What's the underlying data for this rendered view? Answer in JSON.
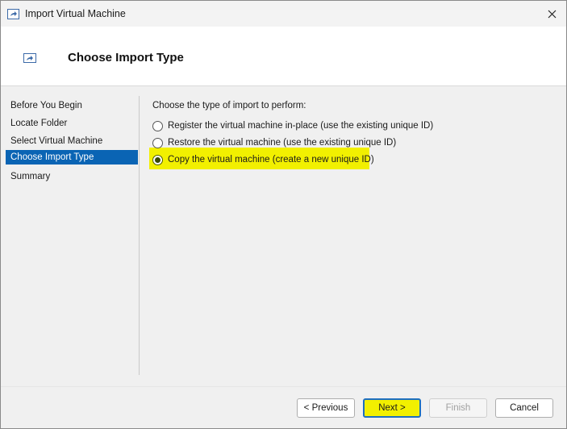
{
  "window": {
    "title": "Import Virtual Machine",
    "close_glyph": "✕"
  },
  "header": {
    "title": "Choose Import Type"
  },
  "sidebar": {
    "items": [
      {
        "label": "Before You Begin",
        "active": false
      },
      {
        "label": "Locate Folder",
        "active": false
      },
      {
        "label": "Select Virtual Machine",
        "active": false
      },
      {
        "label": "Choose Import Type",
        "active": true
      },
      {
        "label": "Summary",
        "active": false
      }
    ]
  },
  "main": {
    "prompt": "Choose the type of import to perform:",
    "options": [
      {
        "label": "Register the virtual machine in-place (use the existing unique ID)",
        "checked": false
      },
      {
        "label": "Restore the virtual machine (use the existing unique ID)",
        "checked": false
      },
      {
        "label": "Copy the virtual machine (create a new unique ID)",
        "checked": true
      }
    ]
  },
  "footer": {
    "previous_label": "< Previous",
    "next_label": "Next >",
    "finish_label": "Finish",
    "cancel_label": "Cancel"
  },
  "colors": {
    "highlight": "#f2f000",
    "selected_nav": "#0a64b4"
  },
  "icons": {
    "title_icon": "import-vm-icon",
    "header_icon": "import-vm-icon",
    "close_icon": "close-icon"
  }
}
